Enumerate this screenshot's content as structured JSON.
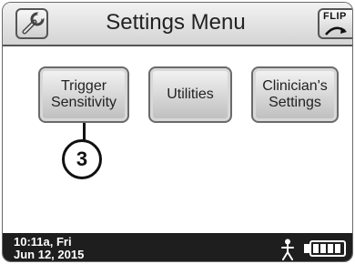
{
  "header": {
    "title": "Settings Menu",
    "left_icon": "wrench-icon",
    "flip_label": "FLIP",
    "flip_icon": "rotate-arrow-icon"
  },
  "menu": {
    "trigger_sensitivity": {
      "line1": "Trigger",
      "line2": "Sensitivity"
    },
    "utilities": {
      "label": "Utilities"
    },
    "clinicians_settings": {
      "line1": "Clinician's",
      "line2": "Settings"
    }
  },
  "callout": {
    "number": "3"
  },
  "status_bar": {
    "time": "10:11a, Fri",
    "date": "Jun 12, 2015",
    "activity_icon": "person-icon",
    "battery_icon": "battery-icon",
    "battery_level": 1.0
  },
  "colors": {
    "status_bar_bg": "#1e1e1e",
    "button_gradient_top": "#f4f4f4",
    "button_gradient_bottom": "#bdbdbd"
  }
}
